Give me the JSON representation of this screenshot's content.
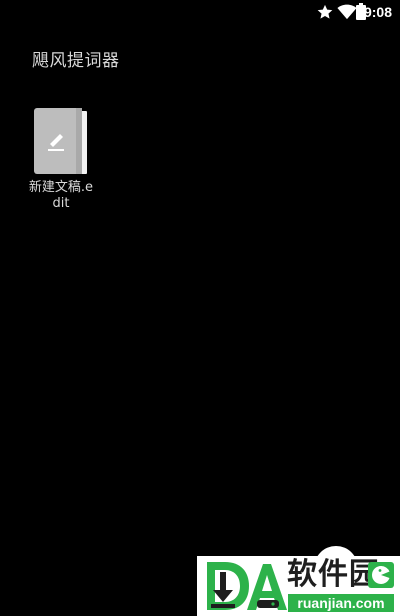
{
  "status_bar": {
    "time": "9:08",
    "icons": [
      "star-icon",
      "wifi-icon",
      "battery-icon"
    ]
  },
  "app": {
    "title": "飓风提词器"
  },
  "files": [
    {
      "name": "新建文稿.edit",
      "icon": "document-edit-icon"
    }
  ],
  "watermark": {
    "title": "软件园",
    "domain": "ruanjian.com",
    "brand_color": "#2db24a"
  },
  "colors": {
    "background": "#000000",
    "text": "#d9d9d9"
  }
}
